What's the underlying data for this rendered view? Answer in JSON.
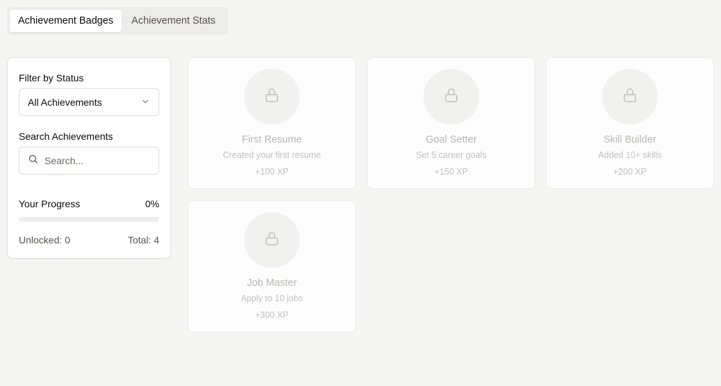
{
  "tabs": [
    {
      "label": "Achievement Badges",
      "active": true
    },
    {
      "label": "Achievement Stats",
      "active": false
    }
  ],
  "sidebar": {
    "filter_label": "Filter by Status",
    "filter_value": "All Achievements",
    "search_label": "Search Achievements",
    "search_placeholder": "Search...",
    "progress_label": "Your Progress",
    "progress_percent": "0%",
    "progress_fraction": 0,
    "unlocked_text": "Unlocked: 0",
    "total_text": "Total: 4"
  },
  "achievements": [
    {
      "title": "First Resume",
      "description": "Created your first resume",
      "xp": "+100 XP",
      "locked": true
    },
    {
      "title": "Goal Setter",
      "description": "Set 5 career goals",
      "xp": "+150 XP",
      "locked": true
    },
    {
      "title": "Skill Builder",
      "description": "Added 10+ skills",
      "xp": "+200 XP",
      "locked": true
    },
    {
      "title": "Job Master",
      "description": "Apply to 10 jobs",
      "xp": "+300 XP",
      "locked": true
    }
  ],
  "icons": {
    "badge_icon": "lock-icon",
    "select_icon": "chevron-down-icon",
    "search_icon": "search-icon"
  },
  "colors": {
    "accent": "#1c1917",
    "background": "#f5f5f4",
    "card_background": "#fdfdfd",
    "locked_text": "#b9b7b4"
  }
}
